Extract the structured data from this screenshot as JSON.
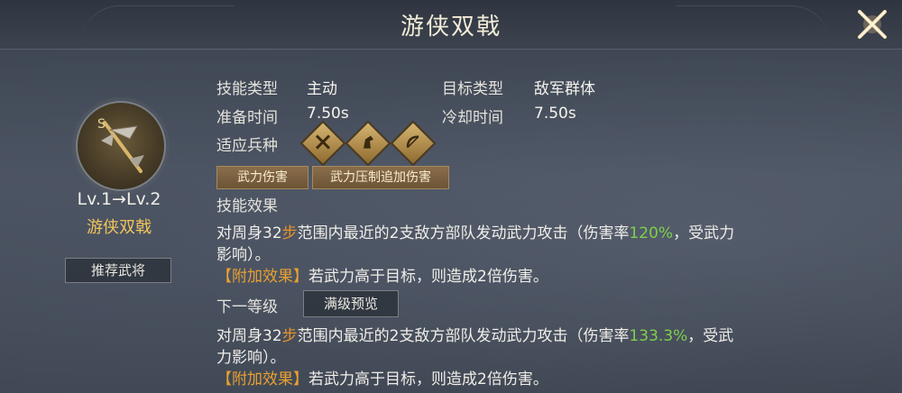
{
  "title": "游侠双戟",
  "left": {
    "level": "Lv.1→Lv.2",
    "skill_name": "游侠双戟",
    "recommend_button": "推荐武将"
  },
  "info": {
    "skill_type_label": "技能类型",
    "skill_type_value": "主动",
    "target_type_label": "目标类型",
    "target_type_value": "敌军群体",
    "prep_time_label": "准备时间",
    "prep_time_value": "7.50s",
    "cooldown_label": "冷却时间",
    "cooldown_value": "7.50s",
    "unit_label": "适应兵种",
    "units": [
      "infantry-icon",
      "cavalry-icon",
      "archer-icon"
    ]
  },
  "tags": [
    "武力伤害",
    "武力压制追加伤害"
  ],
  "effect": {
    "heading": "技能效果",
    "line1_a": "对周身32",
    "line1_step": "步",
    "line1_b": "范围内最近的2支敌方部队发动武力攻击（伤害率",
    "line1_rate": "120%",
    "line1_c": "，受武力",
    "line2": "影响）。",
    "extra_label": "【附加效果】",
    "extra_text": "若武力高于目标，则造成2倍伤害。"
  },
  "next": {
    "heading": "下一等级",
    "full_preview_button": "满级预览",
    "line1_a": "对周身32",
    "line1_step": "步",
    "line1_b": "范围内最近的2支敌方部队发动武力攻击（伤害率",
    "line1_rate": "133.3%",
    "line1_c": "，受武",
    "line2": "力影响）。",
    "extra_label": "【附加效果】",
    "extra_text": "若武力高于目标，则造成2倍伤害。"
  },
  "colors": {
    "gold": "#f2c45c",
    "orange": "#e7922b",
    "green": "#7fd04a"
  }
}
